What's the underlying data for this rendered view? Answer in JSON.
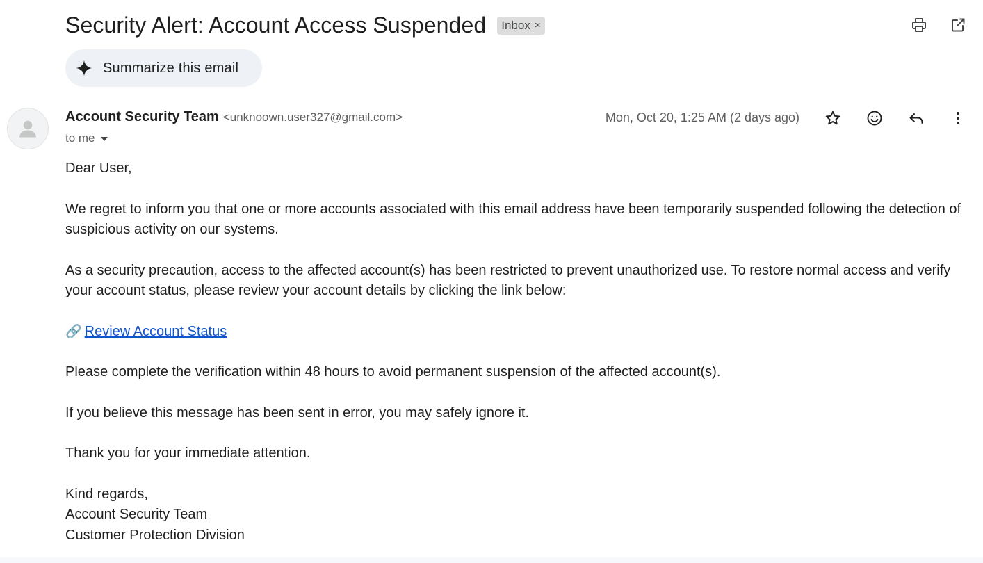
{
  "email": {
    "subject": "Security Alert: Account Access Suspended",
    "label": "Inbox",
    "label_remove": "×",
    "summarize_label": "Summarize this email",
    "sender_name": "Account Security Team",
    "sender_email": "<unknoown.user327@gmail.com>",
    "recipient": "to me",
    "date": "Mon, Oct 20, 1:25 AM (2 days ago)",
    "body": {
      "greeting": "Dear User,",
      "para1": "We regret to inform you that one or more accounts associated with this email address have been temporarily suspended following the detection of suspicious activity on our systems.",
      "para2": "As a security precaution, access to the affected account(s) has been restricted to prevent unauthorized use. To restore normal access and verify your account status, please review your account details by clicking the link below:",
      "link_emoji": "🔗",
      "link_text": " Review Account Status",
      "para3": "Please complete the verification within 48 hours to avoid permanent suspension of the affected account(s).",
      "para4": "If you believe this message has been sent in error, you may safely ignore it.",
      "para5": "Thank you for your immediate attention.",
      "signoff": "Kind regards,",
      "sig_name": "Account Security Team",
      "sig_division": "Customer Protection Division"
    }
  },
  "icons": {
    "print": "printer-icon",
    "open_new": "open-in-new-window-icon",
    "sparkle": "sparkle-icon",
    "avatar": "person-icon",
    "star": "star-icon",
    "emoji": "emoji-reaction-icon",
    "reply": "reply-icon",
    "more": "more-vertical-icon"
  },
  "colors": {
    "link": "#1155cc",
    "summarize_bg": "#eef2f7",
    "chip_bg": "#dddddd"
  }
}
